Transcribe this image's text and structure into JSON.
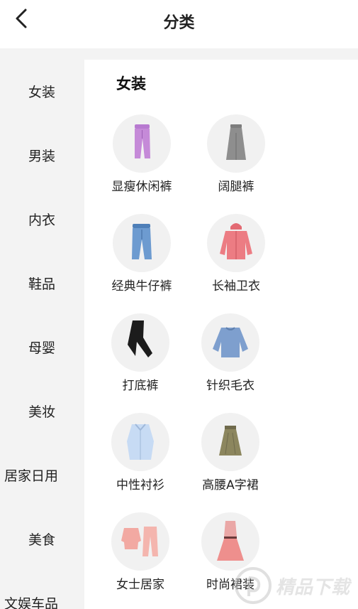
{
  "header": {
    "title": "分类",
    "back_icon": "chevron-left-icon"
  },
  "sidebar": {
    "items": [
      {
        "label": "女装"
      },
      {
        "label": "男装"
      },
      {
        "label": "内衣"
      },
      {
        "label": "鞋品"
      },
      {
        "label": "母婴"
      },
      {
        "label": "美妆"
      },
      {
        "label": "居家日用"
      },
      {
        "label": "美食"
      },
      {
        "label": "文娱车品"
      }
    ]
  },
  "main": {
    "section_title": "女装",
    "categories": [
      {
        "label": "显瘦休闲裤",
        "icon": "purple-pants-icon"
      },
      {
        "label": "阔腿裤",
        "icon": "grey-wide-pants-icon"
      },
      {
        "label": "经典牛仔裤",
        "icon": "jeans-icon"
      },
      {
        "label": "长袖卫衣",
        "icon": "pink-hoodie-icon"
      },
      {
        "label": "打底裤",
        "icon": "black-leggings-icon"
      },
      {
        "label": "针织毛衣",
        "icon": "blue-sweater-icon"
      },
      {
        "label": "中性衬衫",
        "icon": "blue-shirt-icon"
      },
      {
        "label": "高腰A字裙",
        "icon": "olive-skirt-icon"
      },
      {
        "label": "女士居家",
        "icon": "pink-pajamas-icon"
      },
      {
        "label": "时尚裙装",
        "icon": "pink-dress-icon"
      }
    ]
  },
  "watermark": {
    "text": "精品下载",
    "icon": "watermark-logo-icon"
  }
}
